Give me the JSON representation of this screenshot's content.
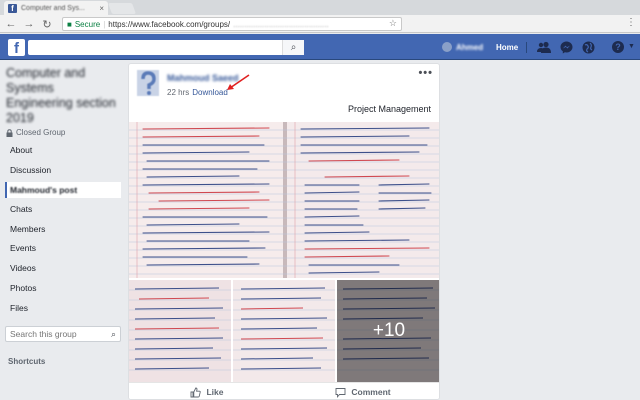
{
  "browser": {
    "tab_title": "Computer and Sys...",
    "tab_close": "×",
    "nav_back": "←",
    "nav_forward": "→",
    "nav_reload": "↻",
    "secure_label": "Secure",
    "url_visible": "https://www.facebook.com/groups/",
    "url_blurred": "...........................................",
    "star_icon": "☆",
    "menu_icon": "⋮"
  },
  "fb_header": {
    "logo": "f",
    "search_placeholder": "",
    "search_icon": "⌕",
    "user_name": "Ahmed",
    "home_label": "Home",
    "friends_icon": "friends-icon",
    "messenger_icon": "messenger-icon",
    "notifications_icon": "globe-icon",
    "help_label": "?",
    "caret": "▼",
    "bar_color": "#4267b2"
  },
  "sidebar": {
    "group_name": "Computer and Systems Engineering section 2019",
    "closed_group_label": "Closed Group",
    "items": [
      {
        "label": "About",
        "active": false
      },
      {
        "label": "Discussion",
        "active": false
      },
      {
        "label": "Mahmoud's post",
        "active": true
      },
      {
        "label": "Chats",
        "active": false
      },
      {
        "label": "Members",
        "active": false
      },
      {
        "label": "Events",
        "active": false
      },
      {
        "label": "Videos",
        "active": false
      },
      {
        "label": "Photos",
        "active": false
      },
      {
        "label": "Files",
        "active": false
      }
    ],
    "search_placeholder": "Search this group",
    "shortcuts_label": "Shortcuts"
  },
  "post": {
    "author": "Mahmoud Saeed",
    "time": "22 hrs",
    "download_link": "Download",
    "more_icon": "•••",
    "text": "Project Management",
    "more_photos_label": "+10",
    "like_label": "Like",
    "comment_label": "Comment",
    "accent_color": "#365899"
  }
}
